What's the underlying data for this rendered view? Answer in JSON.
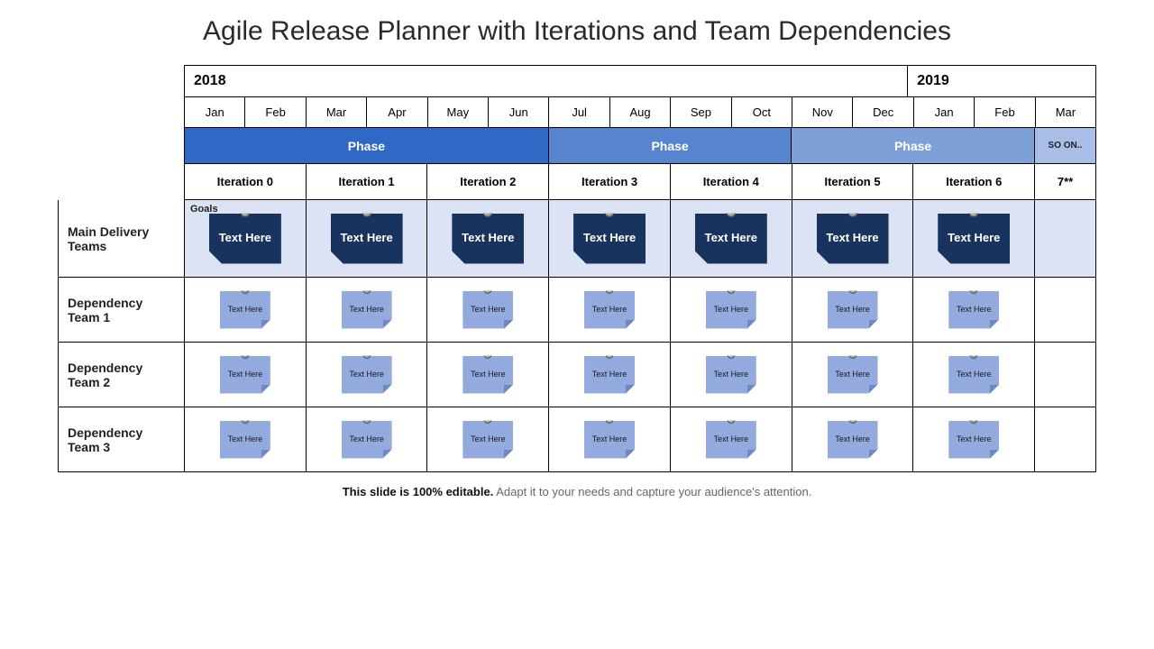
{
  "title": "Agile Release Planner with Iterations and Team Dependencies",
  "years": {
    "y2018": "2018",
    "y2019": "2019"
  },
  "months": [
    "Jan",
    "Feb",
    "Mar",
    "Apr",
    "May",
    "Jun",
    "Jul",
    "Aug",
    "Sep",
    "Oct",
    "Nov",
    "Dec",
    "Jan",
    "Feb",
    "Mar"
  ],
  "phases": {
    "p1": "Phase",
    "p2": "Phase",
    "p3": "Phase",
    "end": "SO ON.."
  },
  "iterations": [
    "Iteration 0",
    "Iteration 1",
    "Iteration 2",
    "Iteration 3",
    "Iteration 4",
    "Iteration 5",
    "Iteration 6",
    "7**"
  ],
  "row_labels": {
    "main": "Main Delivery Teams",
    "goals": "Goals",
    "dep1": "Dependency Team 1",
    "dep2": "Dependency Team 2",
    "dep3": "Dependency Team 3"
  },
  "note_big": "Text Here",
  "note_sm": "Text Here",
  "footer": {
    "bold": "This slide is 100% editable.",
    "rest": " Adapt it to your needs and capture your audience's attention."
  }
}
